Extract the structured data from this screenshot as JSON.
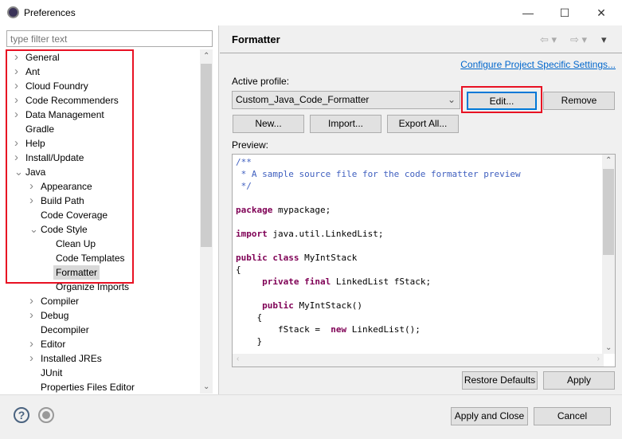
{
  "window": {
    "title": "Preferences",
    "minimize": "—",
    "maximize": "☐",
    "close": "✕"
  },
  "filter": {
    "placeholder": "type filter text"
  },
  "tree": [
    {
      "label": "General",
      "level": 0,
      "expandable": true,
      "expanded": false
    },
    {
      "label": "Ant",
      "level": 0,
      "expandable": true,
      "expanded": false
    },
    {
      "label": "Cloud Foundry",
      "level": 0,
      "expandable": true,
      "expanded": false
    },
    {
      "label": "Code Recommenders",
      "level": 0,
      "expandable": true,
      "expanded": false
    },
    {
      "label": "Data Management",
      "level": 0,
      "expandable": true,
      "expanded": false
    },
    {
      "label": "Gradle",
      "level": 0,
      "expandable": false
    },
    {
      "label": "Help",
      "level": 0,
      "expandable": true,
      "expanded": false
    },
    {
      "label": "Install/Update",
      "level": 0,
      "expandable": true,
      "expanded": false
    },
    {
      "label": "Java",
      "level": 0,
      "expandable": true,
      "expanded": true
    },
    {
      "label": "Appearance",
      "level": 1,
      "expandable": true,
      "expanded": false
    },
    {
      "label": "Build Path",
      "level": 1,
      "expandable": true,
      "expanded": false
    },
    {
      "label": "Code Coverage",
      "level": 1,
      "expandable": false
    },
    {
      "label": "Code Style",
      "level": 1,
      "expandable": true,
      "expanded": true
    },
    {
      "label": "Clean Up",
      "level": 2,
      "expandable": false
    },
    {
      "label": "Code Templates",
      "level": 2,
      "expandable": false
    },
    {
      "label": "Formatter",
      "level": 2,
      "expandable": false,
      "selected": true
    },
    {
      "label": "Organize Imports",
      "level": 2,
      "expandable": false
    },
    {
      "label": "Compiler",
      "level": 1,
      "expandable": true,
      "expanded": false
    },
    {
      "label": "Debug",
      "level": 1,
      "expandable": true,
      "expanded": false
    },
    {
      "label": "Decompiler",
      "level": 1,
      "expandable": false
    },
    {
      "label": "Editor",
      "level": 1,
      "expandable": true,
      "expanded": false
    },
    {
      "label": "Installed JREs",
      "level": 1,
      "expandable": true,
      "expanded": false
    },
    {
      "label": "JUnit",
      "level": 1,
      "expandable": false
    },
    {
      "label": "Properties Files Editor",
      "level": 1,
      "expandable": false
    }
  ],
  "page": {
    "title": "Formatter",
    "link": "Configure Project Specific Settings...",
    "active_profile_label": "Active profile:",
    "profile_value": "Custom_Java_Code_Formatter",
    "edit": "Edit...",
    "remove": "Remove",
    "new": "New...",
    "import": "Import...",
    "export_all": "Export All...",
    "preview_label": "Preview:",
    "restore_defaults": "Restore Defaults",
    "apply": "Apply"
  },
  "preview_code": [
    [
      [
        "cm",
        "/**"
      ]
    ],
    [
      [
        "cm",
        " * A sample source file for the code formatter preview"
      ]
    ],
    [
      [
        "cm",
        " */"
      ]
    ],
    [],
    [
      [
        "kw",
        "package"
      ],
      [
        "",
        "mypackage;"
      ]
    ],
    [],
    [
      [
        "kw",
        "import"
      ],
      [
        "",
        "java.util.LinkedList;"
      ]
    ],
    [],
    [
      [
        "kw",
        "public"
      ],
      [
        "kw",
        "class"
      ],
      [
        "",
        "MyIntStack"
      ]
    ],
    [
      [
        "",
        "{"
      ]
    ],
    [
      [
        "",
        "    "
      ],
      [
        "kw",
        "private"
      ],
      [
        "kw",
        "final"
      ],
      [
        "",
        "LinkedList fStack;"
      ]
    ],
    [],
    [
      [
        "",
        "    "
      ],
      [
        "kw",
        "public"
      ],
      [
        "",
        "MyIntStack()"
      ]
    ],
    [
      [
        "",
        "    {"
      ]
    ],
    [
      [
        "",
        "        fStack = "
      ],
      [
        "kw",
        "new"
      ],
      [
        "",
        "LinkedList();"
      ]
    ],
    [
      [
        "",
        "    }"
      ]
    ]
  ],
  "footer": {
    "apply_and_close": "Apply and Close",
    "cancel": "Cancel"
  },
  "colors": {
    "highlight": "#e81123",
    "keyword": "#7f0055",
    "comment": "#3f5fbf",
    "link": "#0066cc"
  }
}
